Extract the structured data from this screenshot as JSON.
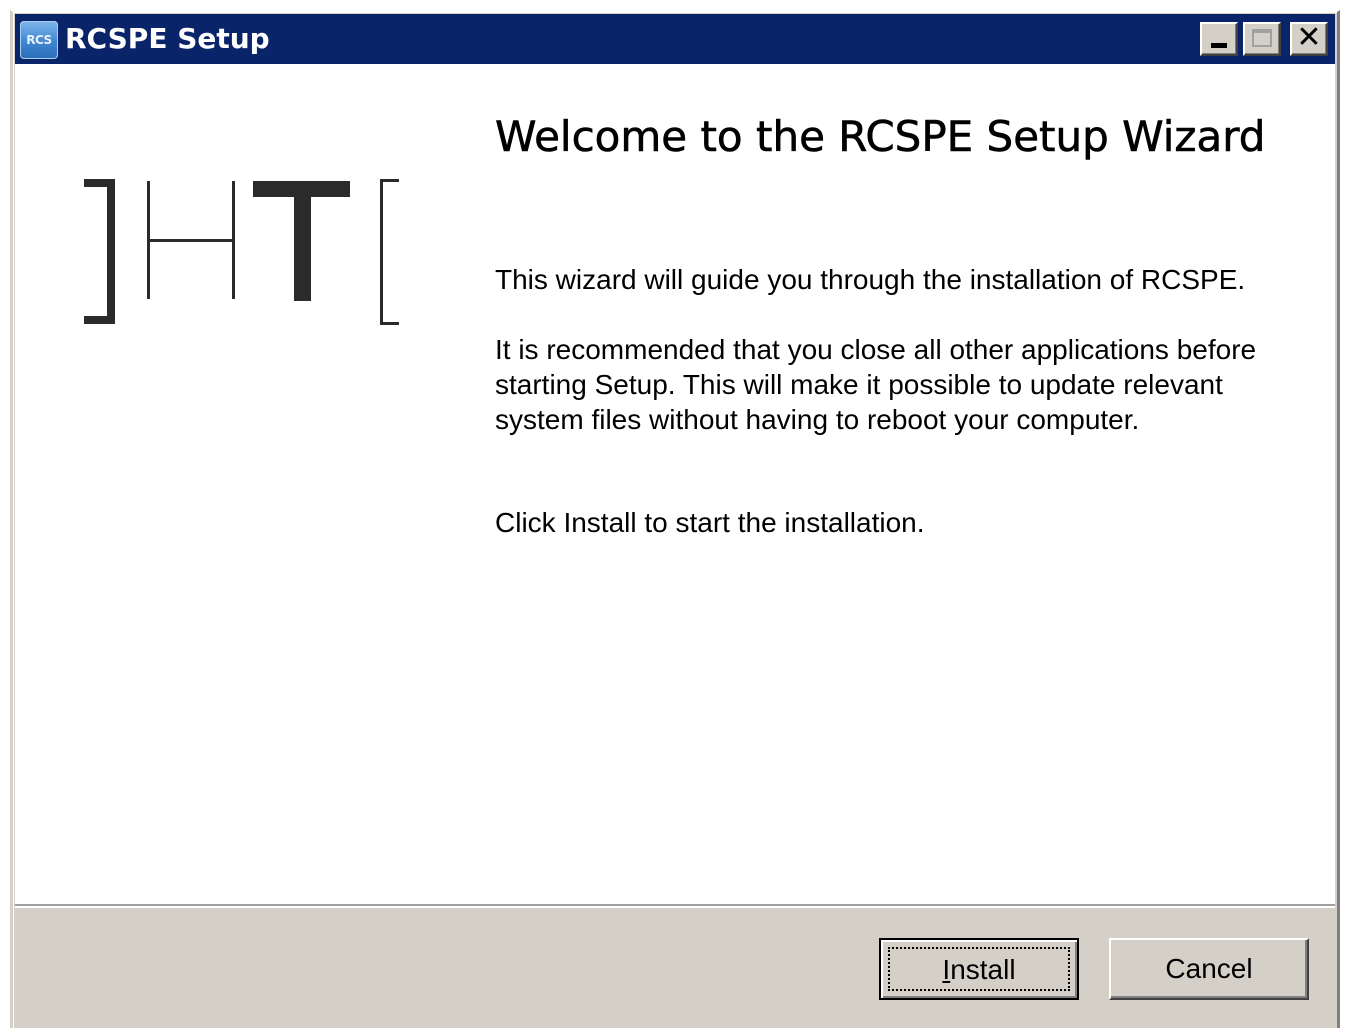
{
  "window": {
    "title": "RCSPE Setup",
    "icon_text": "RCS",
    "icon": "rcs-app-icon",
    "controls": {
      "minimize": "minimize-icon",
      "maximize": "maximize-icon",
      "close": "close-icon"
    }
  },
  "colors": {
    "titlebar": "#0a246a",
    "dialog_face": "#d4d0c8",
    "content_bg": "#ffffff",
    "logo_dark": "#2b2b2b"
  },
  "welcome": {
    "title": "Welcome to the RCSPE Setup Wizard",
    "paragraph1": "This wizard will guide you through the installation of RCSPE.",
    "paragraph2": "It is recommended that you close all other applications before starting Setup. This will make it possible to update relevant system files without having to reboot your computer.",
    "paragraph3": "Click Install to start the installation."
  },
  "buttons": {
    "install_mnemonic": "I",
    "install_rest": "nstall",
    "cancel": "Cancel"
  }
}
